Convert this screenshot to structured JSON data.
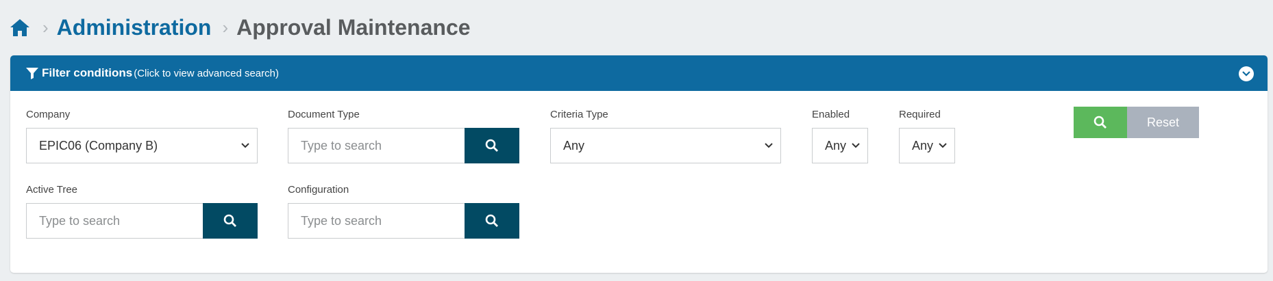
{
  "breadcrumb": {
    "home_icon": "home-icon",
    "parent": "Administration",
    "current": "Approval Maintenance"
  },
  "filter_panel": {
    "title": "Filter conditions",
    "subtitle": "(Click to view advanced search)",
    "collapse_icon": "chevron-down-circle-icon",
    "fields": {
      "company": {
        "label": "Company",
        "value": "EPIC06 (Company B)"
      },
      "document_type": {
        "label": "Document Type",
        "placeholder": "Type to search"
      },
      "criteria_type": {
        "label": "Criteria Type",
        "value": "Any"
      },
      "enabled": {
        "label": "Enabled",
        "value": "Any"
      },
      "required": {
        "label": "Required",
        "value": "Any"
      },
      "active_tree": {
        "label": "Active Tree",
        "placeholder": "Type to search"
      },
      "configuration": {
        "label": "Configuration",
        "placeholder": "Type to search"
      }
    },
    "buttons": {
      "search_icon": "search-icon",
      "reset": "Reset"
    }
  },
  "colors": {
    "header_blue": "#0e6aa0",
    "search_button": "#024a63",
    "green_button": "#5cb85c",
    "reset_button": "#aab2bd",
    "page_bg": "#eceff1"
  }
}
